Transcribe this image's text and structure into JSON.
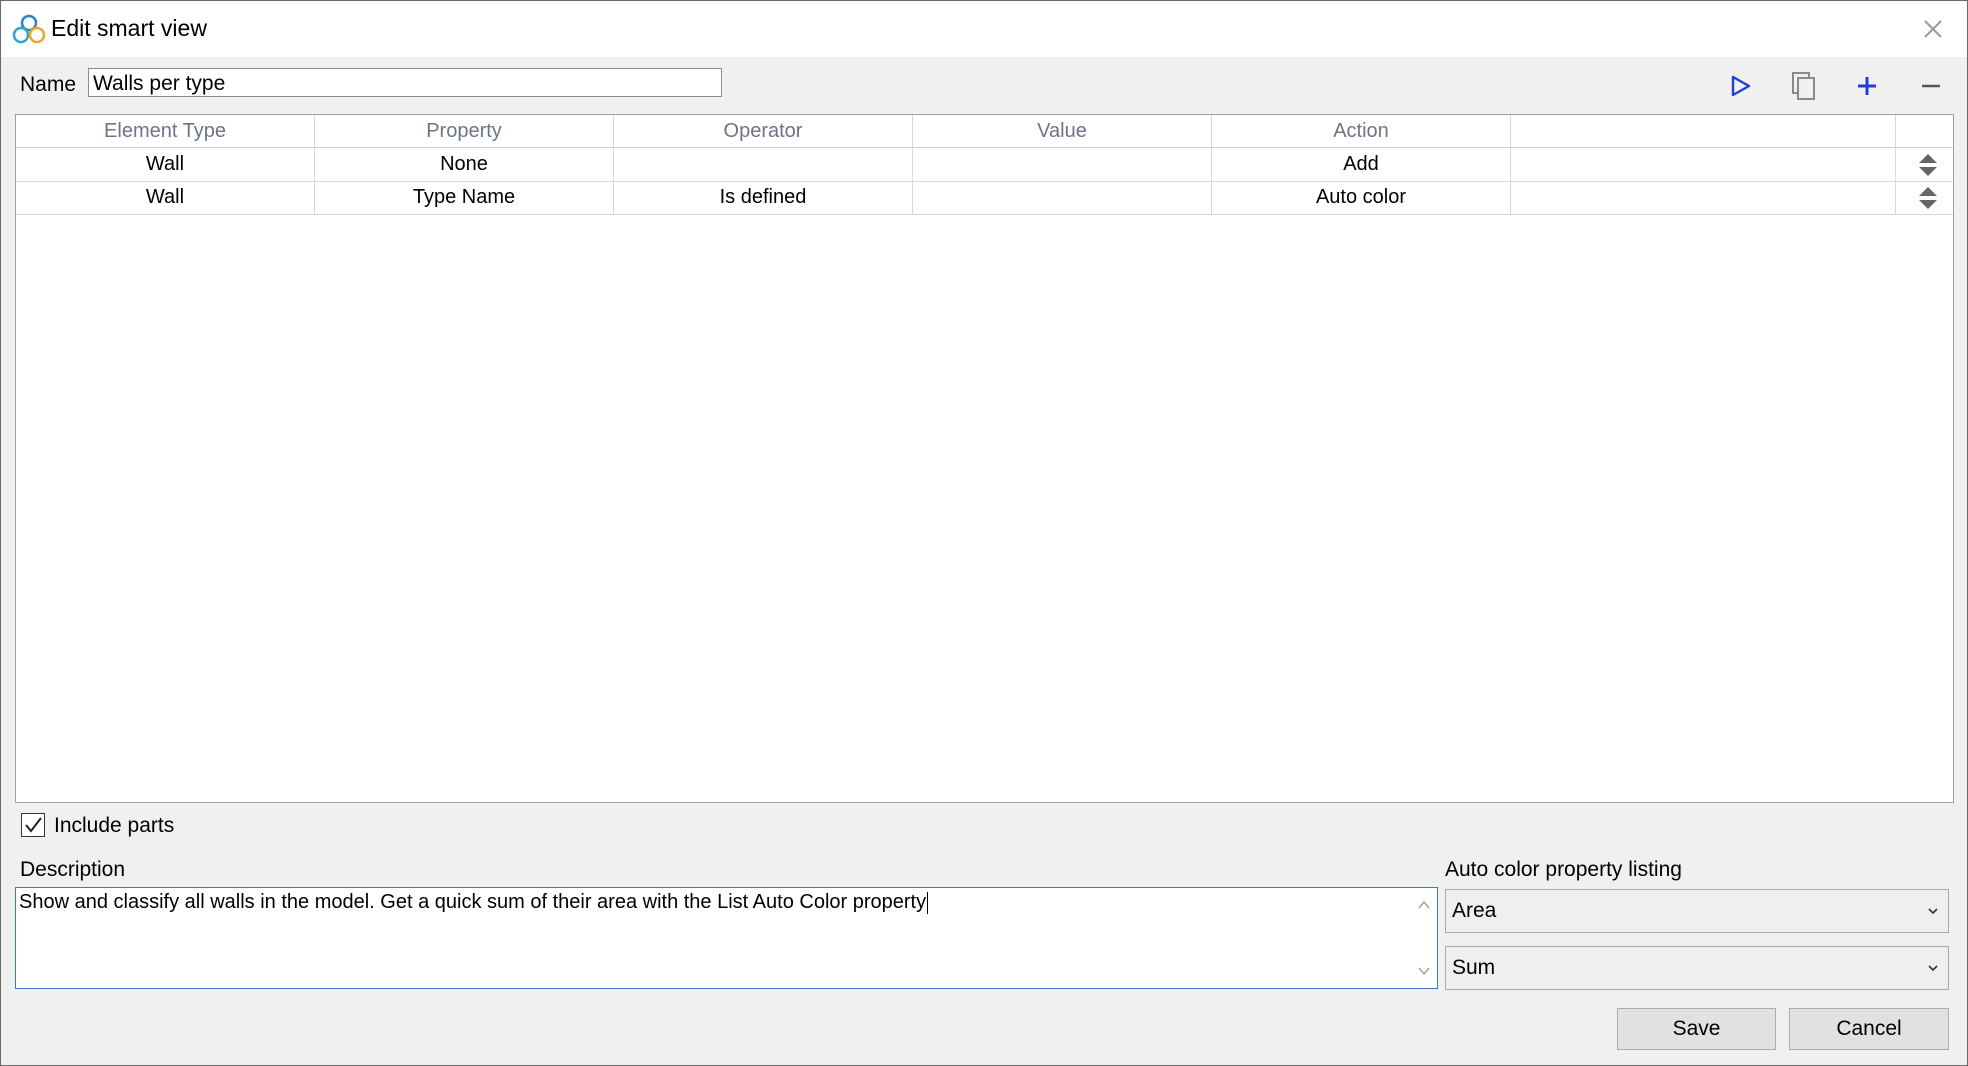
{
  "window": {
    "title": "Edit smart view"
  },
  "name_field": {
    "label": "Name",
    "value": "Walls per type"
  },
  "toolbar": {
    "icons": [
      "play-icon",
      "copy-icon",
      "add-icon",
      "remove-icon"
    ]
  },
  "grid": {
    "columns": [
      "Element Type",
      "Property",
      "Operator",
      "Value",
      "Action",
      ""
    ],
    "rows": [
      [
        "Wall",
        "None",
        "",
        "",
        "Add",
        ""
      ],
      [
        "Wall",
        "Type Name",
        "Is defined",
        "",
        "Auto color",
        ""
      ]
    ]
  },
  "include_parts": {
    "label": "Include parts",
    "checked": true
  },
  "description": {
    "label": "Description",
    "value": "Show and classify all walls in the model. Get a quick sum of their area with the List Auto Color property"
  },
  "auto_color": {
    "label": "Auto color property listing",
    "property_selected": "Area",
    "aggregate_selected": "Sum"
  },
  "buttons": {
    "save": "Save",
    "cancel": "Cancel"
  },
  "colors": {
    "accent_blue": "#1f3fd4",
    "header_text": "#6d7486",
    "focus_border": "#3a7bd5"
  }
}
